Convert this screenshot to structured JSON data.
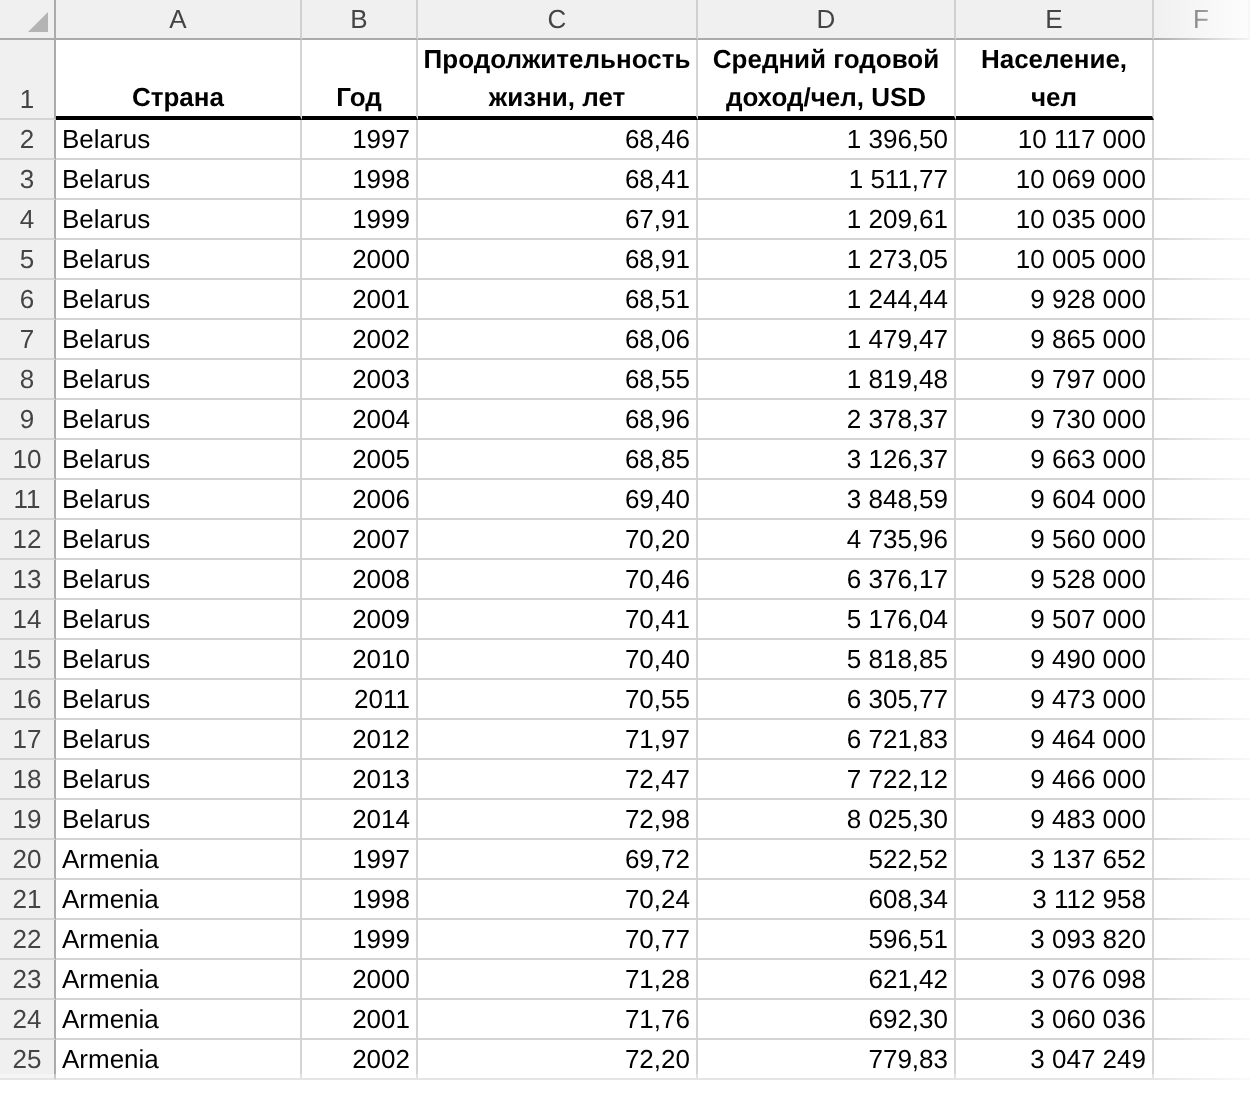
{
  "column_letters": [
    "A",
    "B",
    "C",
    "D",
    "E",
    "F"
  ],
  "header_row": {
    "number": "1",
    "cells": [
      "Страна",
      "Год",
      "Продолжительность жизни, лет",
      "Средний годовой доход/чел, USD",
      "Население, чел"
    ]
  },
  "rows": [
    {
      "number": "2",
      "cells": [
        "Belarus",
        "1997",
        "68,46",
        "1 396,50",
        "10 117 000"
      ]
    },
    {
      "number": "3",
      "cells": [
        "Belarus",
        "1998",
        "68,41",
        "1 511,77",
        "10 069 000"
      ]
    },
    {
      "number": "4",
      "cells": [
        "Belarus",
        "1999",
        "67,91",
        "1 209,61",
        "10 035 000"
      ]
    },
    {
      "number": "5",
      "cells": [
        "Belarus",
        "2000",
        "68,91",
        "1 273,05",
        "10 005 000"
      ]
    },
    {
      "number": "6",
      "cells": [
        "Belarus",
        "2001",
        "68,51",
        "1 244,44",
        "9 928 000"
      ]
    },
    {
      "number": "7",
      "cells": [
        "Belarus",
        "2002",
        "68,06",
        "1 479,47",
        "9 865 000"
      ]
    },
    {
      "number": "8",
      "cells": [
        "Belarus",
        "2003",
        "68,55",
        "1 819,48",
        "9 797 000"
      ]
    },
    {
      "number": "9",
      "cells": [
        "Belarus",
        "2004",
        "68,96",
        "2 378,37",
        "9 730 000"
      ]
    },
    {
      "number": "10",
      "cells": [
        "Belarus",
        "2005",
        "68,85",
        "3 126,37",
        "9 663 000"
      ]
    },
    {
      "number": "11",
      "cells": [
        "Belarus",
        "2006",
        "69,40",
        "3 848,59",
        "9 604 000"
      ]
    },
    {
      "number": "12",
      "cells": [
        "Belarus",
        "2007",
        "70,20",
        "4 735,96",
        "9 560 000"
      ]
    },
    {
      "number": "13",
      "cells": [
        "Belarus",
        "2008",
        "70,46",
        "6 376,17",
        "9 528 000"
      ]
    },
    {
      "number": "14",
      "cells": [
        "Belarus",
        "2009",
        "70,41",
        "5 176,04",
        "9 507 000"
      ]
    },
    {
      "number": "15",
      "cells": [
        "Belarus",
        "2010",
        "70,40",
        "5 818,85",
        "9 490 000"
      ]
    },
    {
      "number": "16",
      "cells": [
        "Belarus",
        "2011",
        "70,55",
        "6 305,77",
        "9 473 000"
      ]
    },
    {
      "number": "17",
      "cells": [
        "Belarus",
        "2012",
        "71,97",
        "6 721,83",
        "9 464 000"
      ]
    },
    {
      "number": "18",
      "cells": [
        "Belarus",
        "2013",
        "72,47",
        "7 722,12",
        "9 466 000"
      ]
    },
    {
      "number": "19",
      "cells": [
        "Belarus",
        "2014",
        "72,98",
        "8 025,30",
        "9 483 000"
      ]
    },
    {
      "number": "20",
      "cells": [
        "Armenia",
        "1997",
        "69,72",
        "522,52",
        "3 137 652"
      ]
    },
    {
      "number": "21",
      "cells": [
        "Armenia",
        "1998",
        "70,24",
        "608,34",
        "3 112 958"
      ]
    },
    {
      "number": "22",
      "cells": [
        "Armenia",
        "1999",
        "70,77",
        "596,51",
        "3 093 820"
      ]
    },
    {
      "number": "23",
      "cells": [
        "Armenia",
        "2000",
        "71,28",
        "621,42",
        "3 076 098"
      ]
    },
    {
      "number": "24",
      "cells": [
        "Armenia",
        "2001",
        "71,76",
        "692,30",
        "3 060 036"
      ]
    },
    {
      "number": "25",
      "cells": [
        "Armenia",
        "2002",
        "72,20",
        "779,83",
        "3 047 249"
      ]
    }
  ]
}
